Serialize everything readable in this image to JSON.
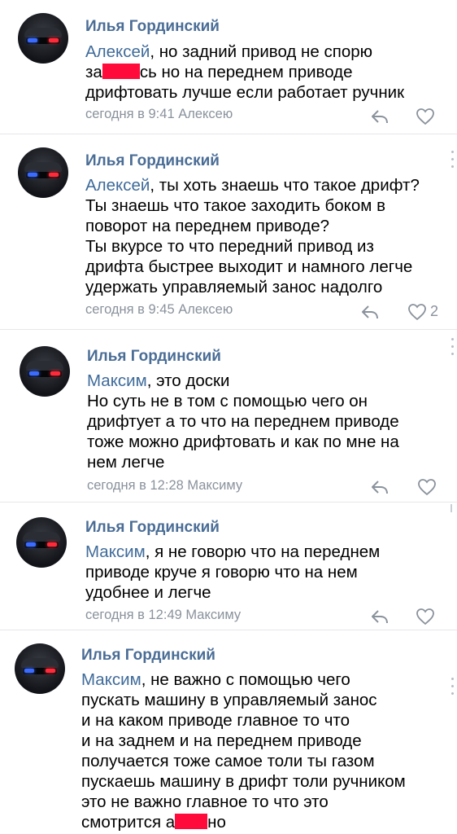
{
  "comments": [
    {
      "author": "Илья Гординский",
      "lines": [
        {
          "mention": "Алексей",
          "text": ", но задний привод не спорю"
        },
        {
          "pre": "за",
          "post": "сь но на переднем приводе"
        },
        {
          "text": "дрифтовать лучше если работает ручник"
        }
      ],
      "meta": "сегодня в 9:41 Алексею",
      "likes": ""
    },
    {
      "author": "Илья Гординский",
      "lines": [
        {
          "mention": "Алексей",
          "text": ", ты хоть знаешь что такое дрифт?"
        },
        {
          "text": "Ты знаешь что такое заходить боком в"
        },
        {
          "text": "поворот на переднем приводе?"
        },
        {
          "text": "Ты вкурсе то что передний привод из"
        },
        {
          "text": "дрифта быстрее выходит и намного легче"
        },
        {
          "text": "удержать управляемый занос надолго"
        }
      ],
      "meta": "сегодня в 9:45 Алексею",
      "likes": "2"
    },
    {
      "author": "Илья Гординский",
      "lines": [
        {
          "mention": "Максим",
          "text": ", это доски"
        },
        {
          "text": "Но суть не в том с помощью чего он"
        },
        {
          "text": "дрифтует а то что на переднем приводе"
        },
        {
          "text": "тоже можно дрифтовать и как по мне на"
        },
        {
          "text": "нем легче"
        }
      ],
      "meta": "сегодня в 12:28 Максиму",
      "likes": ""
    },
    {
      "author": "Илья Гординский",
      "lines": [
        {
          "mention": "Максим",
          "text": ", я не говорю что на переднем"
        },
        {
          "text": "приводе круче я говорю что на нем"
        },
        {
          "text": "удобнее и легче"
        }
      ],
      "meta": "сегодня в 12:49 Максиму",
      "likes": ""
    },
    {
      "author": "Илья Гординский",
      "lines": [
        {
          "mention": "Максим",
          "text": ", не важно с помощью чего"
        },
        {
          "text": "пускать машину в управляемый занос"
        },
        {
          "text": "и на каком приводе главное то что"
        },
        {
          "text": "и на заднем и на переднем приводе"
        },
        {
          "text": "получается тоже самое толи ты газом"
        },
        {
          "text": "пускаешь машину в дрифт толи ручником"
        },
        {
          "text": "это не важно главное то что это"
        },
        {
          "pre": "смотрится а",
          "post": "но"
        }
      ],
      "meta": "",
      "likes": ""
    }
  ],
  "colors": {
    "author": "#4a6d96",
    "mention": "#3f6b9a",
    "meta": "#8a929c",
    "redaction": "#ff0a3a",
    "divider": "#e6e7ea"
  },
  "icons": {
    "reply": "reply-arrow-icon",
    "like": "heart-outline-icon",
    "avatar": "car-avatar"
  }
}
